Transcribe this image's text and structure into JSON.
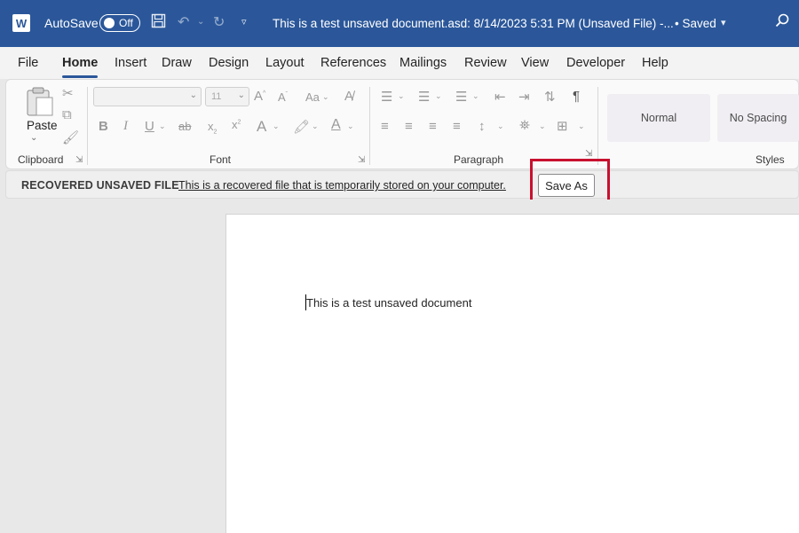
{
  "titlebar": {
    "app_logo": "W",
    "autosave_label": "AutoSave",
    "autosave_state": "Off",
    "doc_title": "This is a test unsaved document.asd: 8/14/2023 5:31 PM (Unsaved File)  -...",
    "saved_status": "• Saved",
    "accent_color": "#2b579a"
  },
  "tabs": [
    "File",
    "Home",
    "Insert",
    "Draw",
    "Design",
    "Layout",
    "References",
    "Mailings",
    "Review",
    "View",
    "Developer",
    "Help"
  ],
  "active_tab": "Home",
  "ribbon": {
    "clipboard": {
      "paste_label": "Paste",
      "group_label": "Clipboard"
    },
    "font": {
      "font_size": "11",
      "group_label": "Font",
      "case_label": "Aa"
    },
    "paragraph": {
      "group_label": "Paragraph"
    },
    "styles": {
      "items": [
        "Normal",
        "No Spacing"
      ],
      "group_label": "Styles"
    }
  },
  "infobar": {
    "title": "RECOVERED UNSAVED FILE",
    "message": "This is a recovered file that is temporarily stored on your computer.",
    "button_label": "Save As",
    "highlight_color": "#c8102e"
  },
  "document": {
    "body_text": "This is a test unsaved document"
  }
}
